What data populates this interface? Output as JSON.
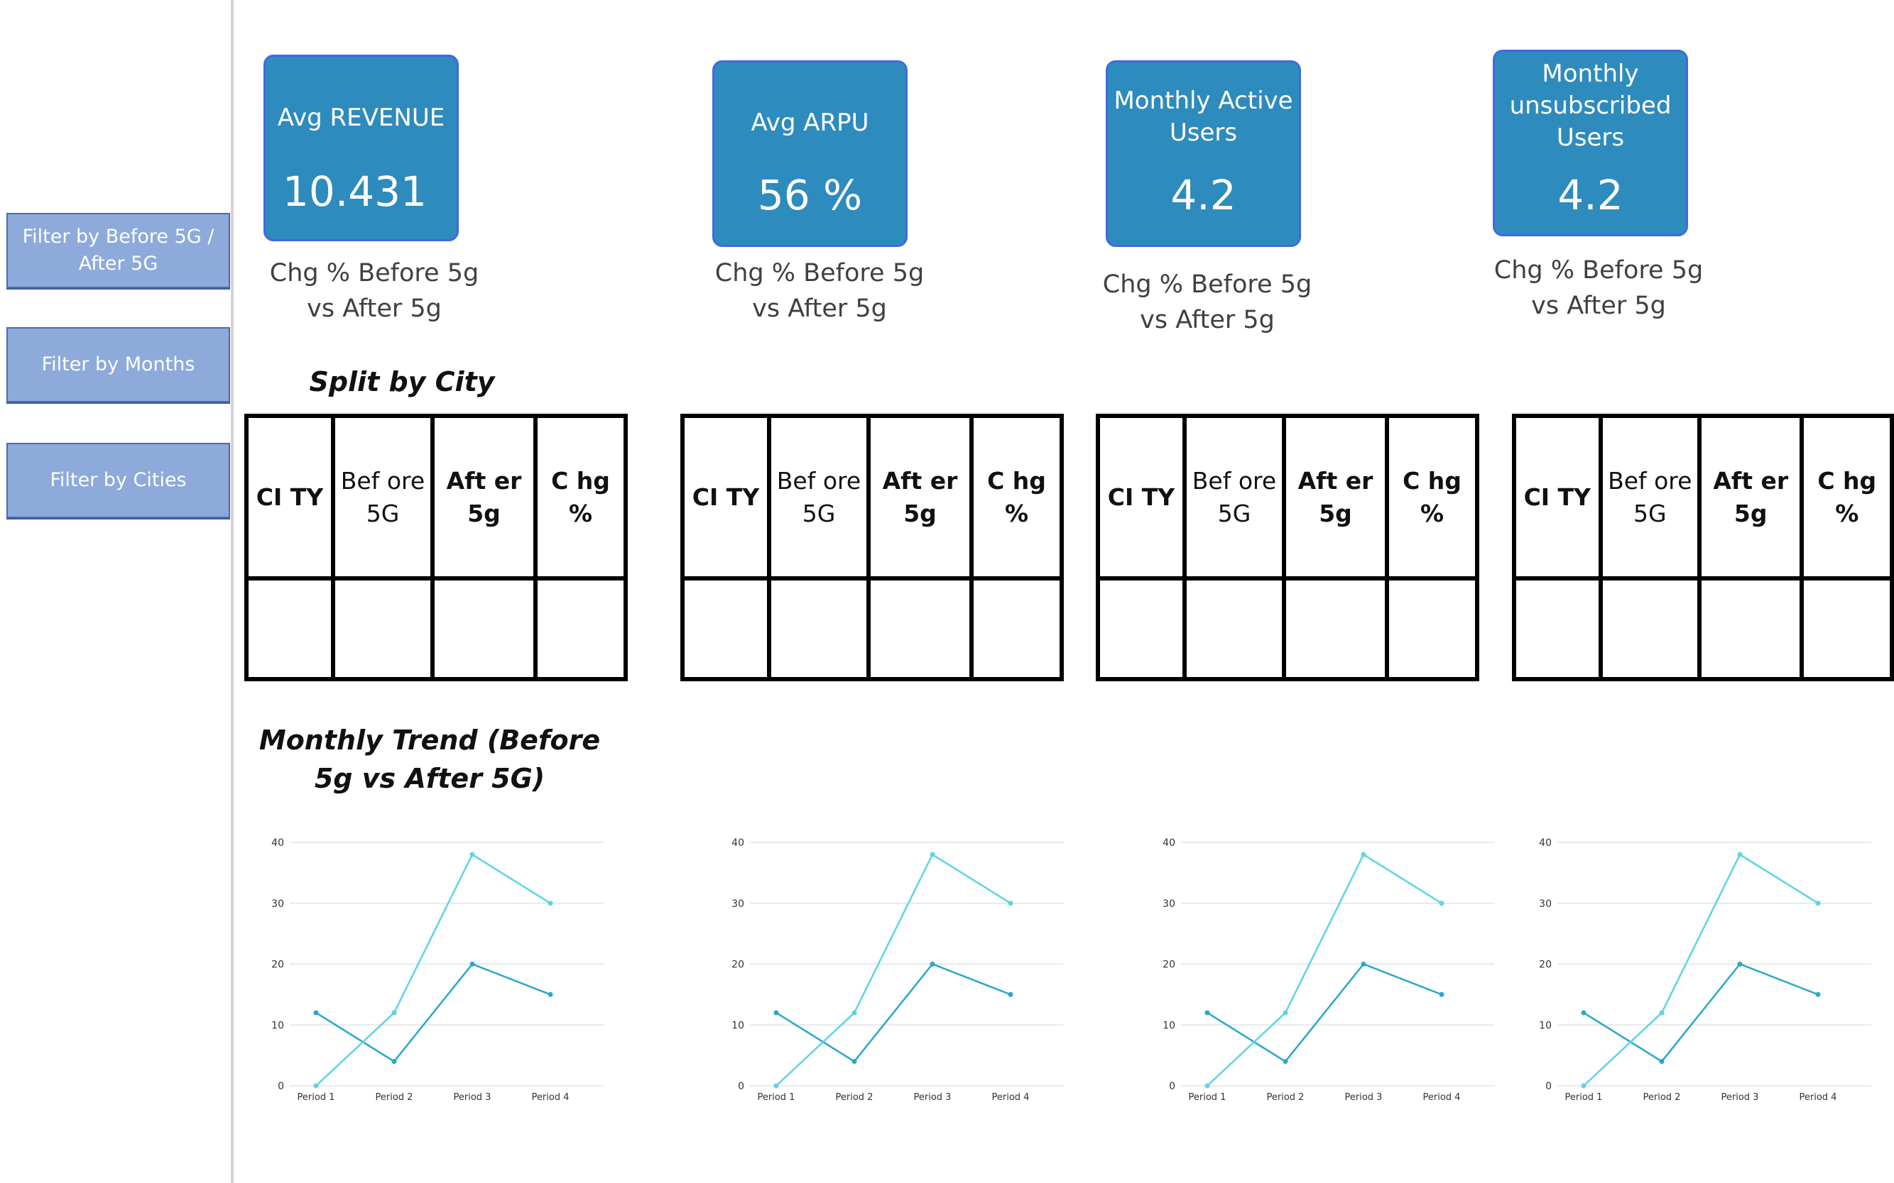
{
  "filters": [
    {
      "label": "Filter by Before 5G / After 5G"
    },
    {
      "label": "Filter by Months"
    },
    {
      "label": "Filter by Cities"
    }
  ],
  "kpis": [
    {
      "title": "Avg REVENUE",
      "value": "10.431",
      "subtitle": "Chg % Before 5g vs After 5g"
    },
    {
      "title": "Avg ARPU",
      "value": "56 %",
      "subtitle": "Chg % Before 5g vs After 5g"
    },
    {
      "title": "Monthly Active Users",
      "value": "4.2",
      "subtitle": "Chg % Before 5g vs After 5g"
    },
    {
      "title": "Monthly unsubscribed Users",
      "value": "4.2",
      "subtitle": "Chg % Before 5g vs After 5g"
    }
  ],
  "sections": {
    "split_by_city": "Split by City",
    "monthly_trend": "Monthly Trend (Before 5g vs After 5G)"
  },
  "city_table": {
    "headers": [
      "CI TY",
      "Bef ore 5G",
      "Aft er 5g",
      "C hg %"
    ]
  },
  "colors": {
    "series_light": "#5ed4e4",
    "series_dark": "#2aa8c8",
    "kpi_card": "#2e8bbd",
    "filter_button": "#8eaadb"
  },
  "chart_data": [
    {
      "type": "line",
      "categories": [
        "Period 1",
        "Period 2",
        "Period 3",
        "Period 4"
      ],
      "ylim": [
        0,
        40
      ],
      "yticks": [
        0,
        10,
        20,
        30,
        40
      ],
      "grid": true,
      "series": [
        {
          "values": [
            12,
            4,
            20,
            15
          ],
          "color": "#2aa8c8"
        },
        {
          "values": [
            0,
            12,
            38,
            30
          ],
          "color": "#5ed4e4"
        }
      ]
    },
    {
      "type": "line",
      "categories": [
        "Period 1",
        "Period 2",
        "Period 3",
        "Period 4"
      ],
      "ylim": [
        0,
        40
      ],
      "yticks": [
        0,
        10,
        20,
        30,
        40
      ],
      "grid": true,
      "series": [
        {
          "values": [
            12,
            4,
            20,
            15
          ],
          "color": "#2aa8c8"
        },
        {
          "values": [
            0,
            12,
            38,
            30
          ],
          "color": "#5ed4e4"
        }
      ]
    },
    {
      "type": "line",
      "categories": [
        "Period 1",
        "Period 2",
        "Period 3",
        "Period 4"
      ],
      "ylim": [
        0,
        40
      ],
      "yticks": [
        0,
        10,
        20,
        30,
        40
      ],
      "grid": true,
      "series": [
        {
          "values": [
            12,
            4,
            20,
            15
          ],
          "color": "#2aa8c8"
        },
        {
          "values": [
            0,
            12,
            38,
            30
          ],
          "color": "#5ed4e4"
        }
      ]
    },
    {
      "type": "line",
      "categories": [
        "Period 1",
        "Period 2",
        "Period 3",
        "Period 4"
      ],
      "ylim": [
        0,
        40
      ],
      "yticks": [
        0,
        10,
        20,
        30,
        40
      ],
      "grid": true,
      "series": [
        {
          "values": [
            12,
            4,
            20,
            15
          ],
          "color": "#2aa8c8"
        },
        {
          "values": [
            0,
            12,
            38,
            30
          ],
          "color": "#5ed4e4"
        }
      ]
    }
  ]
}
